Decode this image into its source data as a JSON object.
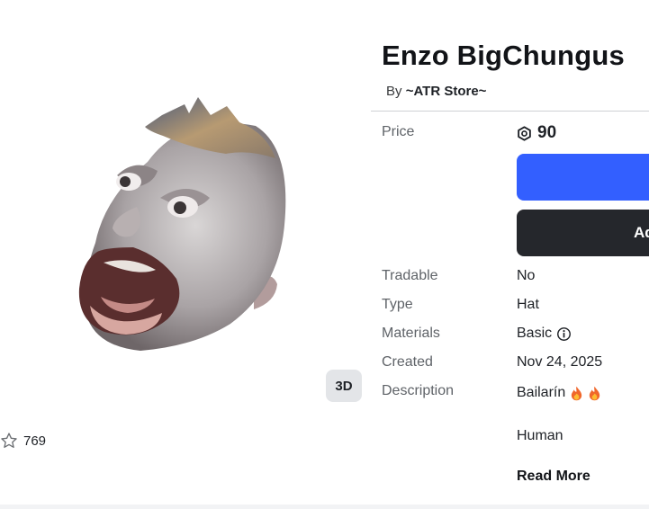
{
  "item": {
    "name": "Enzo BigChungus",
    "by_prefix": "By",
    "creator": "~ATR Store~",
    "favorites": "769",
    "view_3d_label": "3D"
  },
  "details": {
    "price_label": "Price",
    "price_value": "90",
    "currency_icon": "robux-icon",
    "buy_label": "",
    "add_button_label": "Ad",
    "tradable_label": "Tradable",
    "tradable_value": "No",
    "type_label": "Type",
    "type_value": "Hat",
    "materials_label": "Materials",
    "materials_value": "Basic",
    "created_label": "Created",
    "created_value": "Nov 24, 2025",
    "description_label": "Description",
    "description_line1": "Bailarín",
    "description_line2": "Human",
    "read_more_label": "Read More"
  },
  "colors": {
    "buy_button": "#335fff",
    "add_button": "#25272c",
    "label_text": "#5f6368",
    "badge_bg": "#e3e5e8"
  }
}
